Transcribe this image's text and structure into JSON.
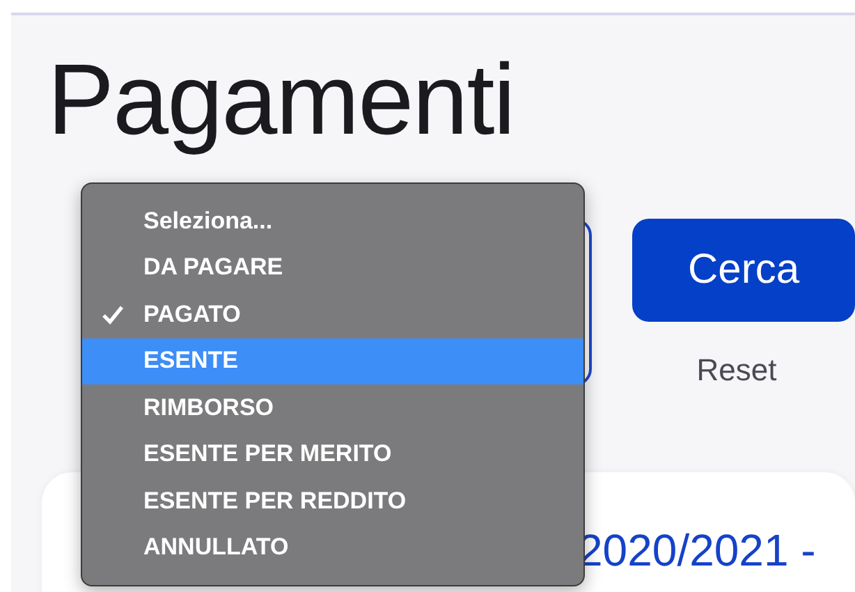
{
  "page": {
    "title": "Pagamenti"
  },
  "filter": {
    "search_button": "Cerca",
    "reset_link": "Reset"
  },
  "dropdown": {
    "options": [
      {
        "label": "Seleziona...",
        "checked": false,
        "selected": false
      },
      {
        "label": "DA PAGARE",
        "checked": false,
        "selected": false
      },
      {
        "label": "PAGATO",
        "checked": true,
        "selected": false
      },
      {
        "label": "ESENTE",
        "checked": false,
        "selected": true
      },
      {
        "label": "RIMBORSO",
        "checked": false,
        "selected": false
      },
      {
        "label": "ESENTE PER MERITO",
        "checked": false,
        "selected": false
      },
      {
        "label": "ESENTE PER REDDITO",
        "checked": false,
        "selected": false
      },
      {
        "label": "ANNULLATO",
        "checked": false,
        "selected": false
      }
    ]
  },
  "card": {
    "title": "2020/2021 -"
  }
}
